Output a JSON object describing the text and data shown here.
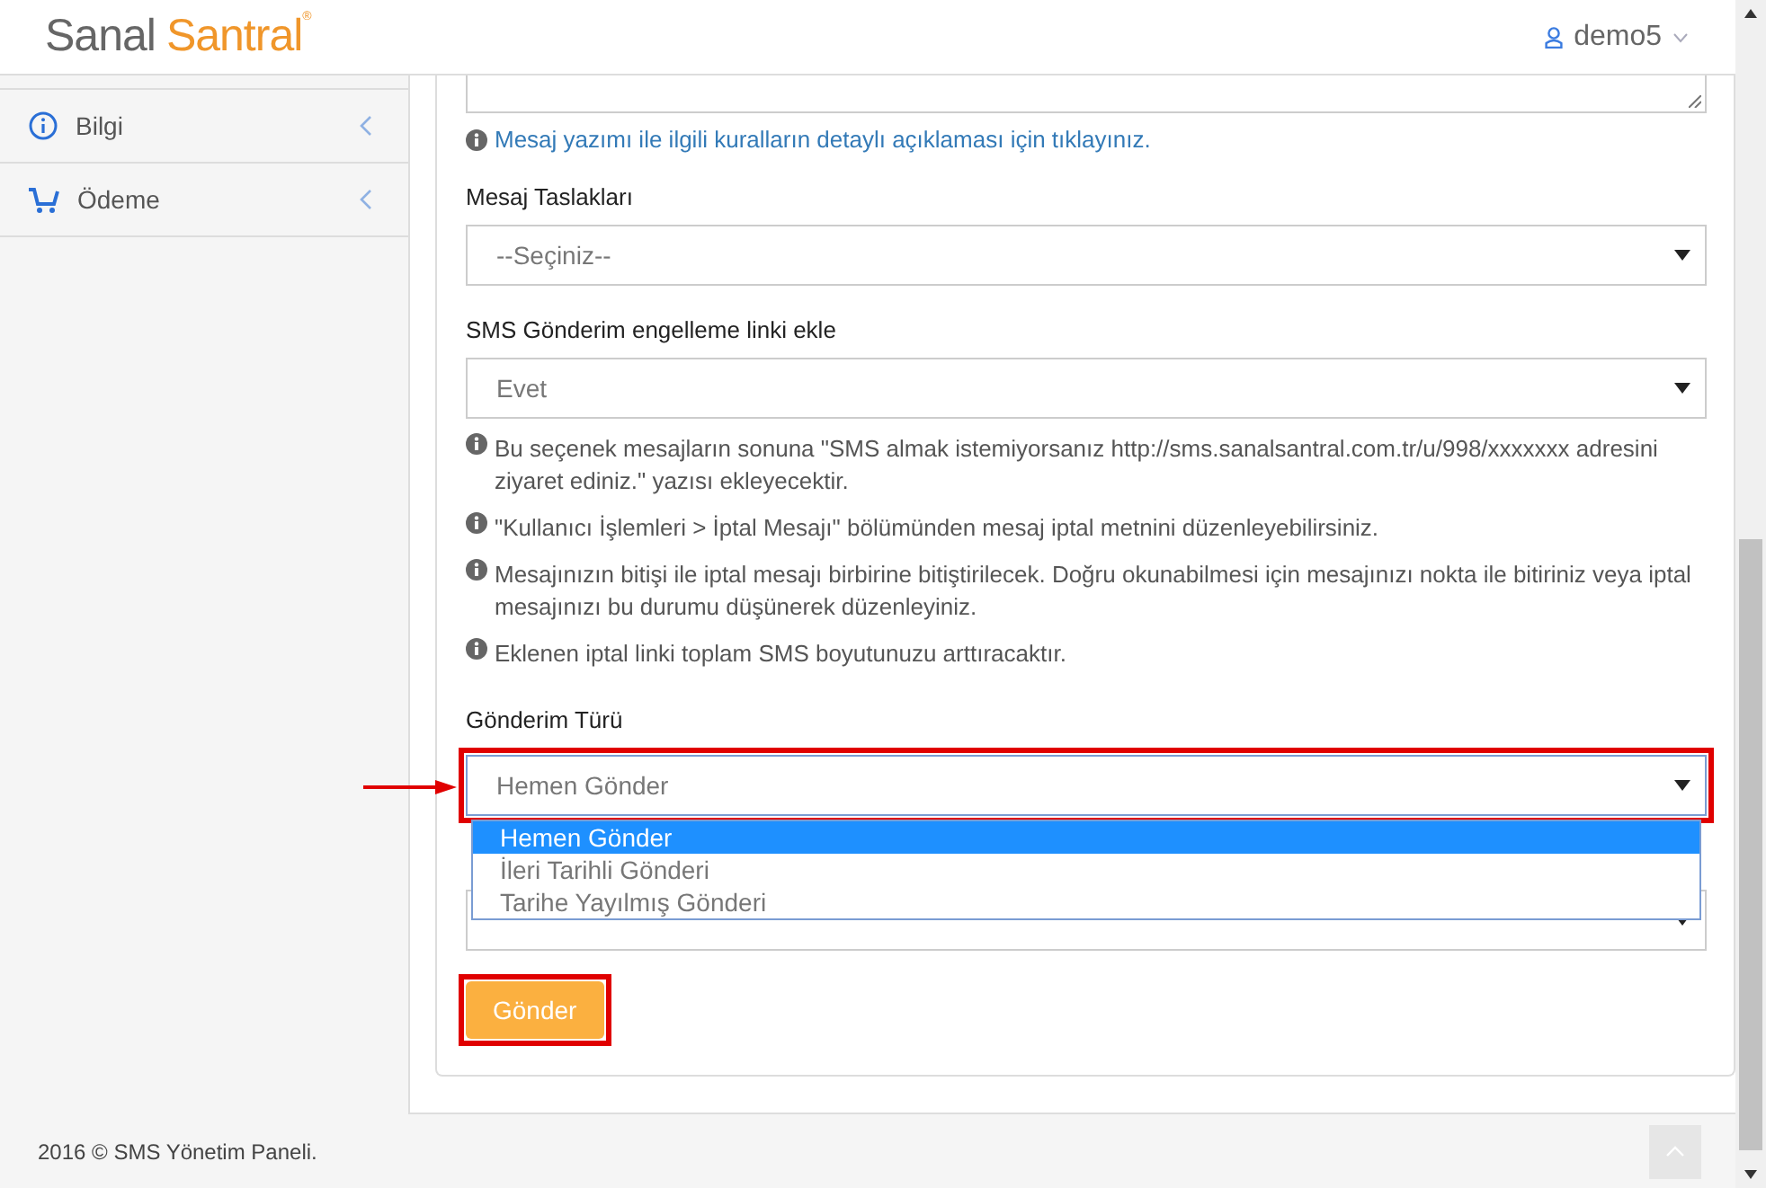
{
  "header": {
    "logo": {
      "first": "Sanal",
      "second": "Santral",
      "mark": "®"
    },
    "user": "demo5"
  },
  "sidebar": {
    "items": [
      {
        "kind": "info",
        "label": "Bilgi"
      },
      {
        "kind": "cart",
        "label": "Ödeme"
      }
    ]
  },
  "form": {
    "rules_link": "Mesaj yazımı ile ilgili kuralların detaylı açıklaması için tıklayınız.",
    "drafts": {
      "label": "Mesaj Taslakları",
      "value": "--Seçiniz--"
    },
    "unsubscribe": {
      "label": "SMS Gönderim engelleme linki ekle",
      "value": "Evet"
    },
    "notes": [
      "Bu seçenek mesajların sonuna \"SMS almak istemiyorsanız http://sms.sanalsantral.com.tr/u/998/xxxxxxx adresini ziyaret ediniz.\" yazısı ekleyecektir.",
      "\"Kullanıcı İşlemleri > İptal Mesajı\" bölümünden mesaj iptal metnini düzenleyebilirsiniz.",
      "Mesajınızın bitişi ile iptal mesajı birbirine bitiştirilecek. Doğru okunabilmesi için mesajınızı nokta ile bitiriniz veya iptal mesajınızı bu durumu düşünerek düzenleyiniz.",
      "Eklenen iptal linki toplam SMS boyutunuzu arttıracaktır."
    ],
    "send_type": {
      "label": "Gönderim Türü",
      "value": "Hemen Gönder",
      "expanded": true,
      "highlighted": true,
      "options": [
        {
          "label": "Hemen Gönder",
          "selected": true
        },
        {
          "label": "İleri Tarihli Gönderi",
          "selected": false
        },
        {
          "label": "Tarihe Yayılmış Gönderi",
          "selected": false
        }
      ]
    },
    "submit": {
      "label": "Gönder",
      "highlighted": true
    }
  },
  "footer": "2016 © SMS Yönetim Paneli."
}
